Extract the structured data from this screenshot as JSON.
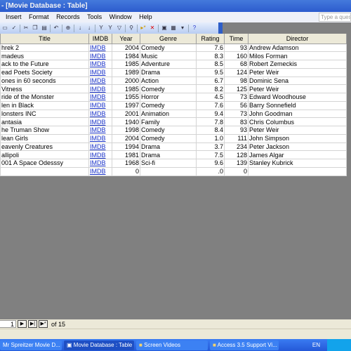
{
  "window": {
    "title": "- [Movie Database : Table]"
  },
  "menu": {
    "items": [
      "Insert",
      "Format",
      "Records",
      "Tools",
      "Window",
      "Help"
    ],
    "ask_placeholder": "Type a question"
  },
  "toolbar": {
    "icons": [
      "print-preview-icon",
      "spelling-icon",
      "cut-icon",
      "copy-icon",
      "paste-icon",
      "undo-icon",
      "hyperlink-icon",
      "sort-ascending-icon",
      "sort-descending-icon",
      "filter-by-selection-icon",
      "filter-by-form-icon",
      "apply-filter-icon",
      "find-icon",
      "new-record-icon",
      "delete-record-icon",
      "database-window-icon",
      "new-object-icon",
      "help-icon"
    ]
  },
  "table": {
    "columns": [
      "Title",
      "IMDB",
      "Year",
      "Genre",
      "Rating",
      "Time",
      "Director"
    ],
    "rows": [
      [
        "hrek 2",
        "IMDB",
        "2004",
        "Comedy",
        "7.6",
        "93",
        "Andrew Adamson"
      ],
      [
        "madeus",
        "IMDB",
        "1984",
        "Music",
        "8.3",
        "160",
        "Milos Forman"
      ],
      [
        "ack to the Future",
        "IMDB",
        "1985",
        "Adventure",
        "8.5",
        "68",
        "Robert Zemeckis"
      ],
      [
        "ead Poets Society",
        "IMDB",
        "1989",
        "Drama",
        "9.5",
        "124",
        "Peter Weir"
      ],
      [
        "ones in 60 seconds",
        "IMDB",
        "2000",
        "Action",
        "6.7",
        "98",
        "Dominic Sena"
      ],
      [
        "Vitness",
        "IMDB",
        "1985",
        "Comedy",
        "8.2",
        "125",
        "Peter Weir"
      ],
      [
        "ride of the Monster",
        "IMDB",
        "1955",
        "Horror",
        "4.5",
        "73",
        "Edward Woodhouse"
      ],
      [
        "len in Black",
        "IMDB",
        "1997",
        "Comedy",
        "7.6",
        "56",
        "Barry Sonnefield"
      ],
      [
        "lonsters INC",
        "IMDB",
        "2001",
        "Animation",
        "9.4",
        "73",
        "John Goodman"
      ],
      [
        "antasia",
        "IMDB",
        "1940",
        "Family",
        "7.8",
        "83",
        "Chris Columbus"
      ],
      [
        "he Truman Show",
        "IMDB",
        "1998",
        "Comedy",
        "8.4",
        "93",
        "Peter Weir"
      ],
      [
        "lean Girls",
        "IMDB",
        "2004",
        "Comedy",
        "1.0",
        "111",
        "John Simpson"
      ],
      [
        "eavenly Creatures",
        "IMDB",
        "1994",
        "Drama",
        "3.7",
        "234",
        "Peter Jackson"
      ],
      [
        "allipoli",
        "IMDB",
        "1981",
        "Drama",
        "7.5",
        "128",
        "James Algar"
      ],
      [
        "001 A Space Odesssy",
        "IMDB",
        "1968",
        "Sci-fi",
        "9.6",
        "139",
        "Stanley Kubrick"
      ],
      [
        "",
        "IMDB",
        "0",
        "",
        ".0",
        "0",
        ""
      ]
    ]
  },
  "navigation": {
    "record": "1",
    "of_label": "of",
    "total": "15"
  },
  "taskbar": {
    "tasks": [
      "Mr Spreitzer Movie D...",
      "Movie Database : Table",
      "Screen Videos",
      "Access 3.5 Support Vi..."
    ],
    "language": "EN"
  }
}
